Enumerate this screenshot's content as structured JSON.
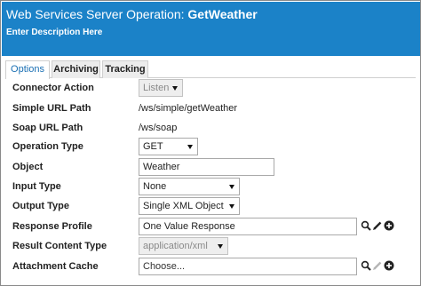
{
  "header": {
    "title_prefix": "Web Services Server Operation: ",
    "title_name": "GetWeather",
    "description": "Enter Description Here",
    "background": "#1b82c8"
  },
  "tabs": [
    {
      "label": "Options",
      "active": true
    },
    {
      "label": "Archiving",
      "active": false
    },
    {
      "label": "Tracking",
      "active": false
    }
  ],
  "form": {
    "connector_action": {
      "label": "Connector Action",
      "value": "Listen",
      "disabled": true
    },
    "simple_url_path": {
      "label": "Simple URL Path",
      "value": "/ws/simple/getWeather"
    },
    "soap_url_path": {
      "label": "Soap URL Path",
      "value": "/ws/soap"
    },
    "operation_type": {
      "label": "Operation Type",
      "value": "GET"
    },
    "object": {
      "label": "Object",
      "value": "Weather"
    },
    "input_type": {
      "label": "Input Type",
      "value": "None"
    },
    "output_type": {
      "label": "Output Type",
      "value": "Single XML Object"
    },
    "response_profile": {
      "label": "Response Profile",
      "value": "One Value Response"
    },
    "result_content_type": {
      "label": "Result Content Type",
      "value": "application/xml",
      "disabled": true
    },
    "attachment_cache": {
      "label": "Attachment Cache",
      "placeholder": "Choose..."
    }
  },
  "icons": {
    "search": "search-icon",
    "edit": "pencil-icon",
    "add": "plus-circle-icon"
  }
}
